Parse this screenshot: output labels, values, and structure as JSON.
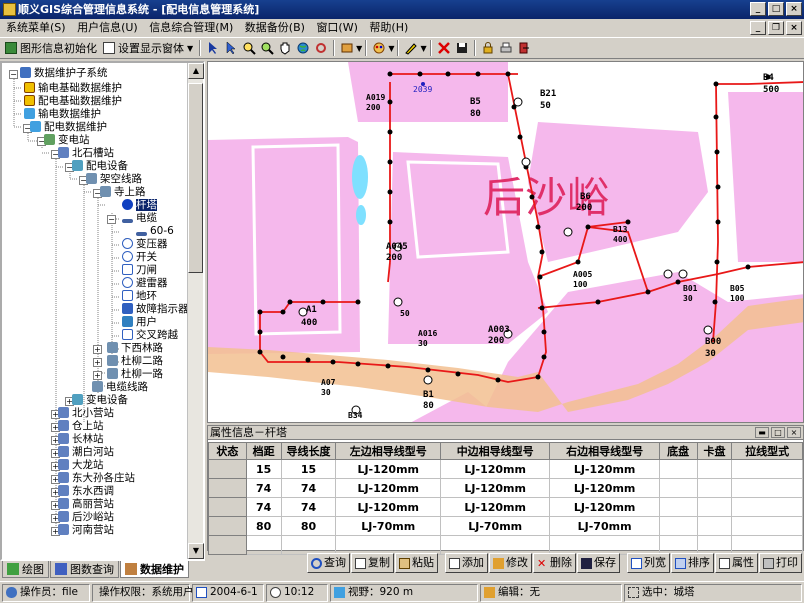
{
  "window": {
    "title": "顺义GIS综合管理信息系统 - [配电信息管理系统]"
  },
  "menu": {
    "items": [
      "系统菜单(S)",
      "用户信息(U)",
      "信息综合管理(M)",
      "数据备份(B)",
      "窗口(W)",
      "帮助(H)"
    ]
  },
  "toolbar": {
    "init_label": "图形信息初始化",
    "display_label": "设置显示窗体",
    "display_arrow": "▼"
  },
  "tree": {
    "root": "数据维护子系统",
    "nodes": [
      "输电基础数据维护",
      "配电基础数据维护",
      "输电数据维护",
      "配电数据维护",
      "变电站",
      "北石槽站",
      "配电设备",
      "架空线路",
      "寺上路",
      "杆塔",
      "电缆",
      "60-6",
      "变压器",
      "开关",
      "刀闸",
      "避雷器",
      "地环",
      "故障指示器",
      "用户",
      "交叉跨越",
      "下西林路",
      "杜柳二路",
      "杜柳一路",
      "电缆线路",
      "变电设备",
      "北小营站",
      "仓上站",
      "长林站",
      "潮白河站",
      "大龙站",
      "东大孙各庄站",
      "东水西调",
      "高丽营站",
      "后沙峪站",
      "河南营站"
    ]
  },
  "left_tabs": [
    "绘图",
    "图数查询",
    "数据维护"
  ],
  "map": {
    "area_name": "后沙峪",
    "labels": {
      "b4": "B4",
      "b4v": "500",
      "b5": "B5",
      "b5v": "80",
      "b21": "B21",
      "b21v": "50",
      "b6": "B6",
      "b6v": "200",
      "a045": "A045",
      "a045v": "200",
      "a1": "A1",
      "a1v": "400",
      "a003": "A003",
      "a003v": "200",
      "b00": "B00",
      "b00v": "30",
      "b1": "B1",
      "b1v": "80",
      "b34": "B34",
      "a07": "A07",
      "a07v": "30",
      "a016": "A016",
      "a016v": "30",
      "a019": "A019",
      "a019v": "200",
      "code2039": "2039",
      "b13": "B13",
      "b13v": "400",
      "a005": "A005",
      "a005v": "100",
      "b01": "B01",
      "b01v": "30",
      "b05": "B05",
      "b05v": "100",
      "b2v": "50"
    }
  },
  "props": {
    "title": "属性信息－杆塔",
    "columns": [
      "状态",
      "档距",
      "导线长度",
      "左边相导线型号",
      "中边相导线型号",
      "右边相导线型号",
      "底盘",
      "卡盘",
      "拉线型式"
    ],
    "rows": [
      [
        "",
        "15",
        "15",
        "LJ-120mm",
        "LJ-120mm",
        "LJ-120mm",
        "",
        "",
        ""
      ],
      [
        "",
        "74",
        "74",
        "LJ-120mm",
        "LJ-120mm",
        "LJ-120mm",
        "",
        "",
        ""
      ],
      [
        "",
        "74",
        "74",
        "LJ-120mm",
        "LJ-120mm",
        "LJ-120mm",
        "",
        "",
        ""
      ],
      [
        "",
        "80",
        "80",
        "LJ-70mm",
        "LJ-70mm",
        "LJ-70mm",
        "",
        "",
        ""
      ],
      [
        "",
        "",
        "",
        "",
        "",
        "",
        "",
        "",
        ""
      ]
    ]
  },
  "buttons": {
    "query": "查询",
    "copy": "复制",
    "paste": "粘贴",
    "add": "添加",
    "edit": "修改",
    "delete": "删除",
    "save": "保存",
    "width": "列宽",
    "sort": "排序",
    "attr": "属性",
    "print": "打印"
  },
  "status": {
    "operator": "操作员：file",
    "permission": "操作权限：系统用户",
    "date": "2004-6-1",
    "time": "10:12",
    "view": "视野：920 m",
    "edit": "编辑：无",
    "selected": "选中：城塔"
  }
}
